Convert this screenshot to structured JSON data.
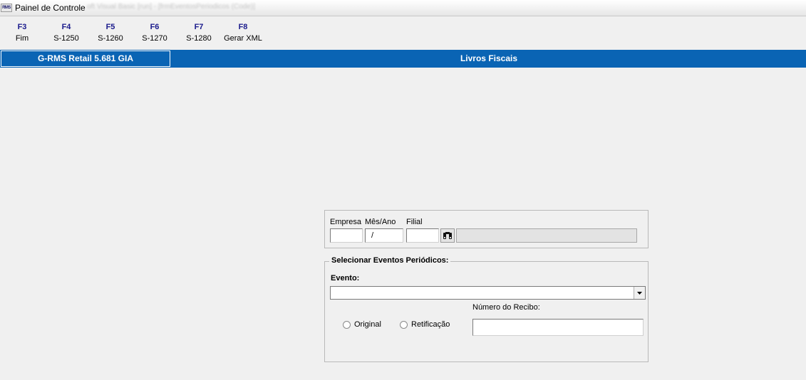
{
  "window": {
    "title": "Painel de Controle",
    "app_icon_label": "RMS",
    "blurred_caption": "oft Visual Basic [run] - [frmEventosPeriodicos (Code)]"
  },
  "function_keys": [
    {
      "key": "F3",
      "label": "Fim"
    },
    {
      "key": "F4",
      "label": "S-1250"
    },
    {
      "key": "F5",
      "label": "S-1260"
    },
    {
      "key": "F6",
      "label": "S-1270"
    },
    {
      "key": "F7",
      "label": "S-1280"
    },
    {
      "key": "F8",
      "label": "Gerar XML"
    }
  ],
  "header": {
    "app_version": "G-RMS Retail 5.681 GIA",
    "module": "Livros Fiscais"
  },
  "filters": {
    "empresa_label": "Empresa",
    "mes_ano_label": "Mês/Ano",
    "filial_label": "Filial",
    "empresa_value": "",
    "mes_ano_value": "/",
    "filial_value": "",
    "search_icon": "binoculars-icon"
  },
  "eventos": {
    "group_title": "Selecionar Eventos Periódicos:",
    "evento_label": "Evento:",
    "evento_value": "",
    "radio_original": "Original",
    "radio_retificacao": "Retificação",
    "recibo_label": "Número do Recibo:",
    "recibo_value": ""
  },
  "colors": {
    "header_blue": "#0a64b4",
    "fkey_blue": "#1a1a8c",
    "background": "#f0f0f0"
  }
}
